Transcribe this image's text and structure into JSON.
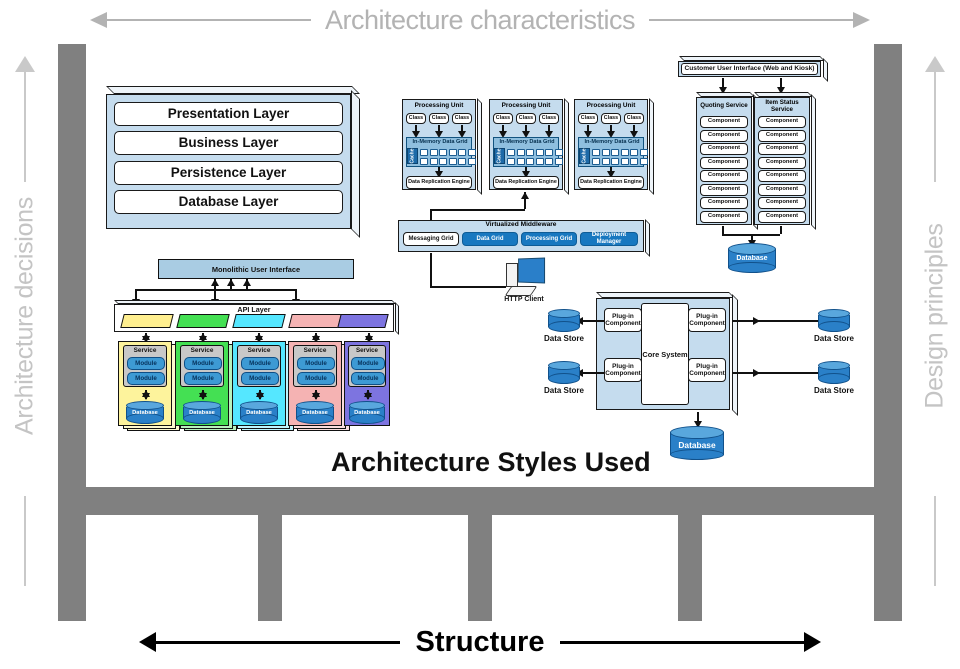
{
  "axes": {
    "top": "Architecture characteristics",
    "bottom": "Structure",
    "left": "Architecture decisions",
    "right": "Design principles"
  },
  "center_title": "Architecture Styles Used",
  "layered": {
    "layers": [
      "Presentation Layer",
      "Business Layer",
      "Persistence Layer",
      "Database Layer"
    ]
  },
  "space_based": {
    "processing_units": [
      {
        "title": "Processing Unit",
        "classes": [
          "Class",
          "Class",
          "Class"
        ],
        "grid_label": "In-Memory Data Grid",
        "cache_label": "Cache",
        "engine": "Data Replication Engine"
      },
      {
        "title": "Processing Unit",
        "classes": [
          "Class",
          "Class",
          "Class"
        ],
        "grid_label": "In-Memory Data Grid",
        "cache_label": "Cache",
        "engine": "Data Replication Engine"
      },
      {
        "title": "Processing Unit",
        "classes": [
          "Class",
          "Class",
          "Class"
        ],
        "grid_label": "In-Memory Data Grid",
        "cache_label": "Cache",
        "engine": "Data Replication Engine"
      }
    ],
    "middleware": {
      "title": "Virtualized Middleware",
      "grids": [
        {
          "label": "Messaging Grid",
          "style": "white"
        },
        {
          "label": "Data Grid",
          "style": "blue"
        },
        {
          "label": "Processing Grid",
          "style": "blue"
        },
        {
          "label": "Deployment Manager",
          "style": "blue"
        }
      ]
    },
    "http_client": "HTTP Client"
  },
  "service_based": {
    "user_interface": "Customer User Interface (Web and Kiosk)",
    "services": [
      {
        "name": "Quoting Service",
        "components": [
          "Component",
          "Component",
          "Component",
          "Component",
          "Component",
          "Component",
          "Component",
          "Component"
        ]
      },
      {
        "name": "Item Status Service",
        "components": [
          "Component",
          "Component",
          "Component",
          "Component",
          "Component",
          "Component",
          "Component",
          "Component"
        ]
      }
    ],
    "database": "Database"
  },
  "microservices": {
    "user_interface": "Monolithic User Interface",
    "api_layer": "API Layer",
    "api_colors": [
      "#ffef8f",
      "#44e053",
      "#55e7ff",
      "#f5b3b3",
      "#7d74e0"
    ],
    "services": [
      {
        "title": "Service",
        "modules": [
          "Module",
          "Module"
        ],
        "database": "Database",
        "color": "#fdf39c",
        "shadow": "#fdf9cd"
      },
      {
        "title": "Service",
        "modules": [
          "Module",
          "Module"
        ],
        "database": "Database",
        "color": "#44e053",
        "shadow": "#b7f2bd"
      },
      {
        "title": "Service",
        "modules": [
          "Module",
          "Module"
        ],
        "database": "Database",
        "color": "#55e7ff",
        "shadow": "#bcf5ff"
      },
      {
        "title": "Service",
        "modules": [
          "Module",
          "Module"
        ],
        "database": "Database",
        "color": "#f5b3b3",
        "shadow": "#fadcdc"
      },
      {
        "title": "Service",
        "modules": [
          "Module",
          "Module"
        ],
        "database": "Database",
        "color": "#7d74e0",
        "shadow": "#c2bdf0"
      }
    ]
  },
  "microkernel": {
    "core": "Core System",
    "plugins": [
      "Plug-in Component",
      "Plug-in Component",
      "Plug-in Component",
      "Plug-in Component"
    ],
    "data_stores": [
      "Data Store",
      "Data Store",
      "Data Store",
      "Data Store"
    ],
    "database": "Database"
  },
  "colors": {
    "pillar": "#808080",
    "box_fill": "#c5dcee",
    "box_side": "#eef4f9",
    "db_blue": "#2a80c8",
    "axis_gray": "#b3b3b3"
  }
}
